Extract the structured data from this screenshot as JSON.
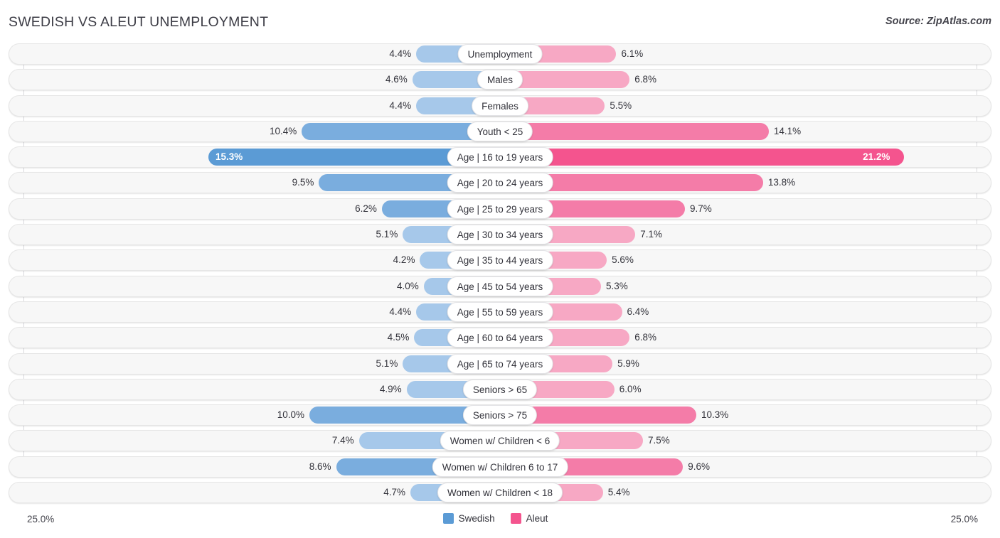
{
  "header": {
    "title": "SWEDISH VS ALEUT UNEMPLOYMENT",
    "source": "Source: ZipAtlas.com"
  },
  "axis": {
    "left_label": "25.0%",
    "right_label": "25.0%",
    "max": 25.0
  },
  "legend": {
    "left_name": "Swedish",
    "right_name": "Aleut",
    "left_color": "#5b9bd5",
    "right_color": "#f4548e"
  },
  "chart_data": {
    "type": "bar",
    "title": "SWEDISH VS ALEUT UNEMPLOYMENT",
    "subtitle": "Source: ZipAtlas.com",
    "orientation": "horizontal-diverging",
    "xlabel": "",
    "ylabel": "",
    "xlim": [
      -25.0,
      25.0
    ],
    "axis_tick_labels": [
      "25.0%",
      "25.0%"
    ],
    "grid": false,
    "legend_position": "bottom-center",
    "categories": [
      "Unemployment",
      "Males",
      "Females",
      "Youth < 25",
      "Age | 16 to 19 years",
      "Age | 20 to 24 years",
      "Age | 25 to 29 years",
      "Age | 30 to 34 years",
      "Age | 35 to 44 years",
      "Age | 45 to 54 years",
      "Age | 55 to 59 years",
      "Age | 60 to 64 years",
      "Age | 65 to 74 years",
      "Seniors > 65",
      "Seniors > 75",
      "Women w/ Children < 6",
      "Women w/ Children 6 to 17",
      "Women w/ Children < 18"
    ],
    "series": [
      {
        "name": "Swedish",
        "color": "#5b9bd5",
        "values": [
          4.4,
          4.6,
          4.4,
          10.4,
          15.3,
          9.5,
          6.2,
          5.1,
          4.2,
          4.0,
          4.4,
          4.5,
          5.1,
          4.9,
          10.0,
          7.4,
          8.6,
          4.7
        ],
        "labels": [
          "4.4%",
          "4.6%",
          "4.4%",
          "10.4%",
          "15.3%",
          "9.5%",
          "6.2%",
          "5.1%",
          "4.2%",
          "4.0%",
          "4.4%",
          "4.5%",
          "5.1%",
          "4.9%",
          "10.0%",
          "7.4%",
          "8.6%",
          "4.7%"
        ]
      },
      {
        "name": "Aleut",
        "color": "#f4548e",
        "values": [
          6.1,
          6.8,
          5.5,
          14.1,
          21.2,
          13.8,
          9.7,
          7.1,
          5.6,
          5.3,
          6.4,
          6.8,
          5.9,
          6.0,
          10.3,
          7.5,
          9.6,
          5.4
        ],
        "labels": [
          "6.1%",
          "6.8%",
          "5.5%",
          "14.1%",
          "21.2%",
          "13.8%",
          "9.7%",
          "7.1%",
          "5.6%",
          "5.3%",
          "6.4%",
          "6.8%",
          "5.9%",
          "6.0%",
          "10.3%",
          "7.5%",
          "9.6%",
          "5.4%"
        ]
      }
    ]
  },
  "rows": [
    {
      "label": "Unemployment",
      "left": 4.4,
      "left_label": "4.4%",
      "right": 6.1,
      "right_label": "6.1%",
      "shade": 0
    },
    {
      "label": "Males",
      "left": 4.6,
      "left_label": "4.6%",
      "right": 6.8,
      "right_label": "6.8%",
      "shade": 0
    },
    {
      "label": "Females",
      "left": 4.4,
      "left_label": "4.4%",
      "right": 5.5,
      "right_label": "5.5%",
      "shade": 0
    },
    {
      "label": "Youth < 25",
      "left": 10.4,
      "left_label": "10.4%",
      "right": 14.1,
      "right_label": "14.1%",
      "shade": 1
    },
    {
      "label": "Age | 16 to 19 years",
      "left": 15.3,
      "left_label": "15.3%",
      "right": 21.2,
      "right_label": "21.2%",
      "shade": 2
    },
    {
      "label": "Age | 20 to 24 years",
      "left": 9.5,
      "left_label": "9.5%",
      "right": 13.8,
      "right_label": "13.8%",
      "shade": 1
    },
    {
      "label": "Age | 25 to 29 years",
      "left": 6.2,
      "left_label": "6.2%",
      "right": 9.7,
      "right_label": "9.7%",
      "shade": 1
    },
    {
      "label": "Age | 30 to 34 years",
      "left": 5.1,
      "left_label": "5.1%",
      "right": 7.1,
      "right_label": "7.1%",
      "shade": 0
    },
    {
      "label": "Age | 35 to 44 years",
      "left": 4.2,
      "left_label": "4.2%",
      "right": 5.6,
      "right_label": "5.6%",
      "shade": 0
    },
    {
      "label": "Age | 45 to 54 years",
      "left": 4.0,
      "left_label": "4.0%",
      "right": 5.3,
      "right_label": "5.3%",
      "shade": 0
    },
    {
      "label": "Age | 55 to 59 years",
      "left": 4.4,
      "left_label": "4.4%",
      "right": 6.4,
      "right_label": "6.4%",
      "shade": 0
    },
    {
      "label": "Age | 60 to 64 years",
      "left": 4.5,
      "left_label": "4.5%",
      "right": 6.8,
      "right_label": "6.8%",
      "shade": 0
    },
    {
      "label": "Age | 65 to 74 years",
      "left": 5.1,
      "left_label": "5.1%",
      "right": 5.9,
      "right_label": "5.9%",
      "shade": 0
    },
    {
      "label": "Seniors > 65",
      "left": 4.9,
      "left_label": "4.9%",
      "right": 6.0,
      "right_label": "6.0%",
      "shade": 0
    },
    {
      "label": "Seniors > 75",
      "left": 10.0,
      "left_label": "10.0%",
      "right": 10.3,
      "right_label": "10.3%",
      "shade": 1
    },
    {
      "label": "Women w/ Children < 6",
      "left": 7.4,
      "left_label": "7.4%",
      "right": 7.5,
      "right_label": "7.5%",
      "shade": 0
    },
    {
      "label": "Women w/ Children 6 to 17",
      "left": 8.6,
      "left_label": "8.6%",
      "right": 9.6,
      "right_label": "9.6%",
      "shade": 1
    },
    {
      "label": "Women w/ Children < 18",
      "left": 4.7,
      "left_label": "4.7%",
      "right": 5.4,
      "right_label": "5.4%",
      "shade": 0
    }
  ]
}
